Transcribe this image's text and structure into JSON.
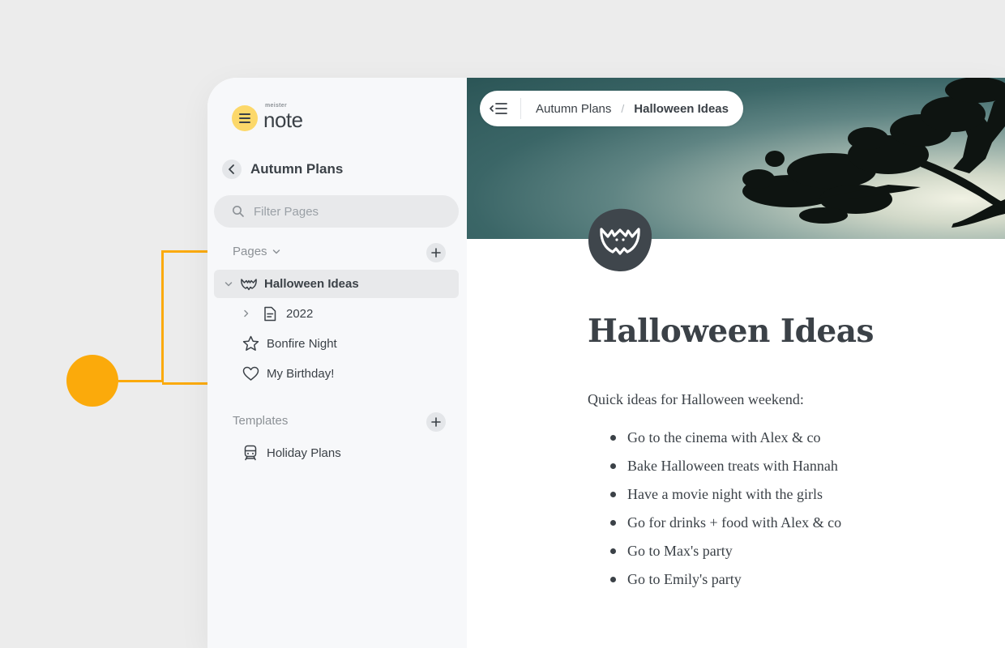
{
  "app": {
    "logo_small": "meister",
    "logo_big": "note"
  },
  "sidebar": {
    "back_title": "Autumn Plans",
    "filter_placeholder": "Filter Pages",
    "pages_label": "Pages",
    "pages": [
      {
        "label": "Halloween Ideas",
        "icon": "bat-icon",
        "expanded": true,
        "active": true
      },
      {
        "label": "2022",
        "icon": "document-icon",
        "expanded": false
      },
      {
        "label": "Bonfire Night",
        "icon": "star-icon"
      },
      {
        "label": "My Birthday!",
        "icon": "heart-icon"
      }
    ],
    "templates_label": "Templates",
    "templates": [
      {
        "label": "Holiday Plans",
        "icon": "train-icon"
      }
    ]
  },
  "breadcrumb": {
    "parent": "Autumn Plans",
    "current": "Halloween Ideas"
  },
  "page": {
    "icon": "bat-icon",
    "title": "Halloween Ideas",
    "intro": "Quick ideas for Halloween weekend:",
    "items": [
      "Go to the cinema with Alex & co",
      "Bake Halloween treats with Hannah",
      "Have a movie night with the girls",
      "Go for drinks + food with Alex & co",
      "Go to Max's party",
      "Go to Emily's party"
    ]
  },
  "colors": {
    "accent": "#fbaa0b",
    "logo": "#fcd86a",
    "text": "#3b4147",
    "sidebar_bg": "#f7f8fa"
  }
}
